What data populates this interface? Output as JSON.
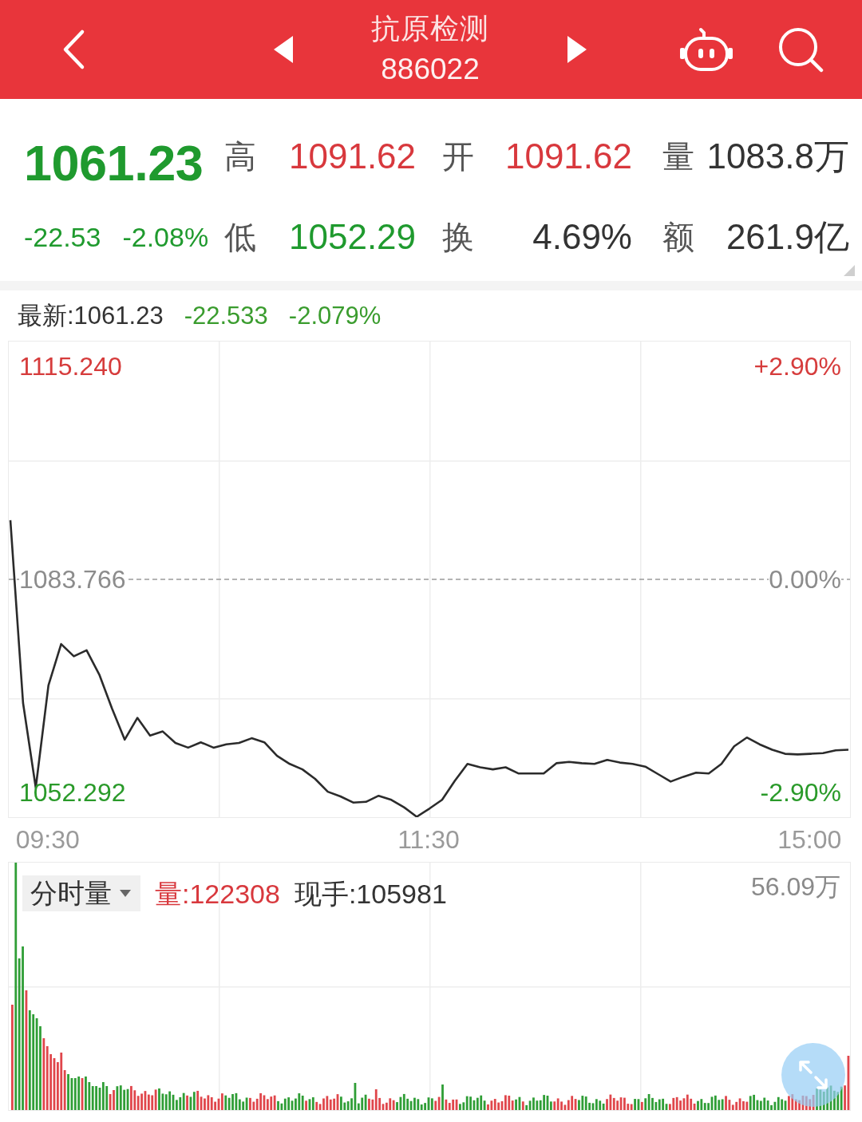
{
  "header": {
    "title": "抗原检测",
    "code": "886022"
  },
  "quote": {
    "rows": [
      {
        "lead": [
          {
            "kind": "price",
            "text": "1061.23",
            "color": "#1f9a2e"
          }
        ],
        "fields": [
          {
            "label": "高",
            "value": "1091.62",
            "color": "#d8383d"
          },
          {
            "label": "开",
            "value": "1091.62",
            "color": "#d8383d"
          },
          {
            "label": "量",
            "value": "1083.8万",
            "color": "#333333"
          }
        ]
      },
      {
        "lead": [
          {
            "kind": "change",
            "text": "-22.53",
            "color": "#1f9a2e"
          },
          {
            "kind": "percent",
            "text": "-2.08%",
            "color": "#1f9a2e"
          }
        ],
        "fields": [
          {
            "label": "低",
            "value": "1052.29",
            "color": "#1f9a2e"
          },
          {
            "label": "换",
            "value": "4.69%",
            "color": "#333333"
          },
          {
            "label": "额",
            "value": "261.9亿",
            "color": "#333333"
          }
        ]
      }
    ]
  },
  "price_chart": {
    "header": [
      {
        "text": "最新:1061.23",
        "color": "#333333"
      },
      {
        "text": "-22.533",
        "color": "#3a9c2e"
      },
      {
        "text": "-2.079%",
        "color": "#3a9c2e"
      }
    ],
    "chart_data": {
      "type": "line",
      "categories": [
        null,
        null,
        null,
        "09:30",
        null,
        null,
        null,
        null,
        null,
        null,
        null,
        null,
        null,
        null,
        null,
        null,
        null,
        null,
        null,
        null,
        null,
        null,
        null,
        null,
        null,
        null,
        null,
        null,
        null,
        null,
        null,
        null,
        null,
        "11:30",
        null,
        null,
        null,
        null,
        null,
        null,
        null,
        null,
        null,
        null,
        null,
        null,
        null,
        null,
        null,
        null,
        null,
        null,
        null,
        null,
        null,
        null,
        null,
        null,
        null,
        null,
        null,
        null,
        null,
        "15:00",
        null,
        null,
        null
      ],
      "series": [
        {
          "color": "#2b2b2b",
          "values": [
            1092.5,
            1065.5,
            1053.0,
            1068.1,
            1074.2,
            1072.4,
            1073.3,
            1069.7,
            1064.7,
            1060.1,
            1063.3,
            1060.7,
            1061.3,
            1059.6,
            1058.9,
            1059.7,
            1058.9,
            1059.4,
            1059.6,
            1060.3,
            1059.7,
            1057.7,
            1056.5,
            1055.7,
            1054.3,
            1052.4,
            1051.7,
            1050.8,
            1050.9,
            1051.8,
            1051.2,
            1050.1,
            1048.7,
            1049.9,
            1051.2,
            1054.0,
            1056.5,
            1056.0,
            1055.7,
            1056.0,
            1055.1,
            1055.1,
            1055.1,
            1056.6,
            1056.8,
            1056.6,
            1056.5,
            1057.1,
            1056.7,
            1056.5,
            1056.1,
            1055.0,
            1053.9,
            1054.6,
            1055.2,
            1055.1,
            1056.5,
            1059.1,
            1060.4,
            1059.4,
            1058.6,
            1058.0,
            1057.9,
            1058.0,
            1058.1,
            1058.5,
            1058.6
          ]
        }
      ],
      "ylim": [
        1048.637,
        1118.895
      ],
      "yticks": [
        {
          "value": 1115.24,
          "label": "1115.240"
        },
        {
          "value": 1083.766,
          "label": "1083.766"
        },
        {
          "value": 1052.292,
          "label": "1052.292"
        }
      ],
      "ref_lines": [
        {
          "axis": "y",
          "value": 1083.766,
          "color": "#9a9a9a"
        }
      ]
    },
    "right_axis_labels": [
      {
        "text": "+2.90%",
        "color": "#d63c3c"
      },
      {
        "text": "0.00%",
        "color": "#8c8c8c"
      },
      {
        "text": "-2.90%",
        "color": "#2a9a2a"
      }
    ]
  },
  "volume_panel": {
    "selector": "分时量",
    "readings": [
      {
        "text": "量:122308",
        "color": "#d8383d"
      },
      {
        "text": "现手:105981",
        "color": "#333333"
      }
    ],
    "max_label": "56.09万"
  }
}
